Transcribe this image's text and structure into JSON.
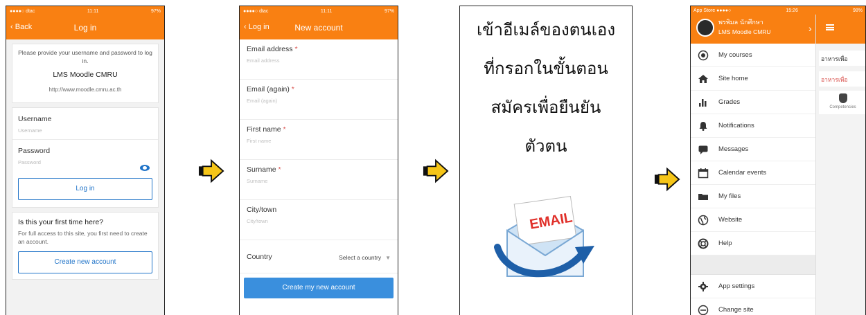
{
  "phone1": {
    "status": {
      "carrier": "●●●●○ dtac",
      "time": "11:11",
      "battery": "97%"
    },
    "nav": {
      "back": "Back",
      "title": "Log in"
    },
    "intro": {
      "text": "Please provide your username and password to log in.",
      "site_name": "LMS Moodle CMRU",
      "site_url": "http://www.moodle.cmru.ac.th"
    },
    "username": {
      "label": "Username",
      "placeholder": "Username"
    },
    "password": {
      "label": "Password",
      "placeholder": "Password"
    },
    "login_button": "Log in",
    "first_time": {
      "question": "Is this your first time here?",
      "text": "For full access to this site, you first need to create an account."
    },
    "create_button": "Create new account"
  },
  "phone2": {
    "status": {
      "carrier": "●●●●○ dtac",
      "time": "11:11",
      "battery": "97%"
    },
    "nav": {
      "back": "Log in",
      "title": "New account"
    },
    "fields": [
      {
        "label": "Email address",
        "req": "*",
        "placeholder": "Email address"
      },
      {
        "label": "Email (again)",
        "req": "*",
        "placeholder": "Email (again)"
      },
      {
        "label": "First name",
        "req": "*",
        "placeholder": "First name"
      },
      {
        "label": "Surname",
        "req": "*",
        "placeholder": "Surname"
      },
      {
        "label": "City/town",
        "req": "",
        "placeholder": "City/town"
      }
    ],
    "country": {
      "label": "Country",
      "value": "Select a country"
    },
    "submit": "Create my new account"
  },
  "panel": {
    "lines": [
      "เข้าอีเมล์ของตนเอง",
      "ที่กรอกในขั้นตอน",
      "สมัครเพื่อยืนยัน",
      "ตัวตน"
    ],
    "envelope_text": "EMAIL"
  },
  "phone4": {
    "status": {
      "app": "App Store ●●●●○",
      "time": "15:26",
      "battery": "98%"
    },
    "user_name": "พรพิมล นักศึกษา",
    "site": "LMS Moodle CMRU",
    "menu": [
      {
        "label": "My courses",
        "icon": "radio-icon"
      },
      {
        "label": "Site home",
        "icon": "home-icon"
      },
      {
        "label": "Grades",
        "icon": "bar-chart-icon"
      },
      {
        "label": "Notifications",
        "icon": "bell-icon"
      },
      {
        "label": "Messages",
        "icon": "chat-icon"
      },
      {
        "label": "Calendar events",
        "icon": "calendar-icon"
      },
      {
        "label": "My files",
        "icon": "folder-icon"
      },
      {
        "label": "Website",
        "icon": "globe-icon"
      },
      {
        "label": "Help",
        "icon": "lifebuoy-icon"
      }
    ],
    "settings": "App settings",
    "change_site": "Change site",
    "right": {
      "item1": "อาหารเพื่อ",
      "item2": "อาหารเพื่อ",
      "item3": "Competencies"
    }
  },
  "colors": {
    "brand": "#f98012",
    "link": "#1f73c8",
    "primary_button": "#3a8fdd",
    "arrow_fill": "#f5c518"
  }
}
